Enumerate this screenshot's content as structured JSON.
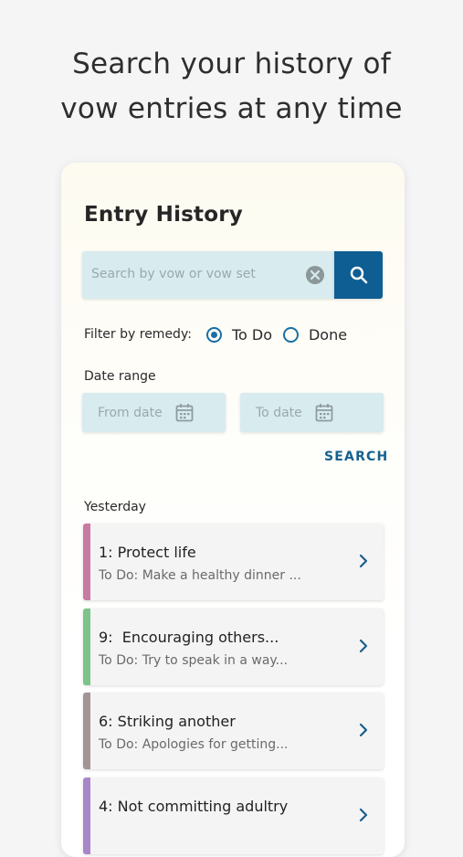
{
  "headline": [
    "Search your history of",
    "vow entries at any time"
  ],
  "screen": {
    "title": "Entry History",
    "search": {
      "placeholder": "Search by vow or vow set",
      "clear_icon": "clear-circle-icon",
      "button_icon": "search-icon"
    },
    "filter": {
      "label": "Filter by remedy:",
      "options": [
        {
          "label": "To Do",
          "selected": true
        },
        {
          "label": "Done",
          "selected": false
        }
      ]
    },
    "date_range": {
      "label": "Date range",
      "from_placeholder": "From date",
      "to_placeholder": "To date",
      "icon": "calendar-icon"
    },
    "search_action": "SEARCH",
    "groups": [
      {
        "label": "Yesterday",
        "entries": [
          {
            "title": "1: Protect life",
            "subtitle": "To Do: Make a healthy dinner ...",
            "color": "#c97aa2"
          },
          {
            "title": "9:  Encouraging others...",
            "subtitle": "To Do: Try to speak in a way...",
            "color": "#7cc48a"
          },
          {
            "title": "6: Striking another",
            "subtitle": "To Do: Apologies for getting...",
            "color": "#a49496"
          },
          {
            "title": "4: Not committing adultry",
            "subtitle": "",
            "color": "#a985c9"
          }
        ]
      }
    ]
  },
  "colors": {
    "accent": "#0e5e93",
    "field_bg": "#d8ebef",
    "page_bg": "#f5f5f6"
  }
}
